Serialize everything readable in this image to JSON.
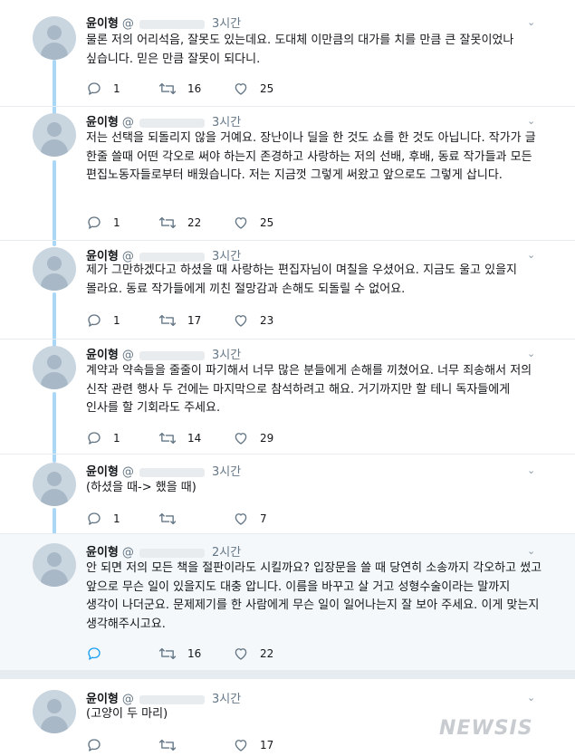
{
  "tweets": [
    {
      "name": "윤이형",
      "handle": "@",
      "time": "3시간",
      "text": "물론 저의 어리석음, 잘못도 있는데요. 도대체 이만큼의 대가를 치를 만큼 큰 잘못이었나 싶습니다. 믿은 만큼 잘못이 되다니.",
      "replies": "1",
      "retweets": "16",
      "likes": "25"
    },
    {
      "name": "윤이형",
      "handle": "@",
      "time": "3시간",
      "text": "저는 선택을 되돌리지 않을 거예요. 장난이나 딜을 한 것도 쇼를 한 것도 아닙니다. 작가가 글 한줄 쓸때 어떤 각오로 써야 하는지 존경하고 사랑하는 저의 선배, 후배, 동료 작가들과 모든 편집노동자들로부터 배웠습니다. 저는 지금껏 그렇게 써왔고 앞으로도 그렇게 삽니다.",
      "replies": "1",
      "retweets": "22",
      "likes": "25"
    },
    {
      "name": "윤이형",
      "handle": "@",
      "time": "3시간",
      "text": "제가 그만하겠다고 하셨을 때 사랑하는 편집자님이 며칠을 우셨어요. 지금도 울고 있을지 몰라요. 동료 작가들에게 끼친 절망감과 손해도 되돌릴 수 없어요.",
      "replies": "1",
      "retweets": "17",
      "likes": "23"
    },
    {
      "name": "윤이형",
      "handle": "@",
      "time": "3시간",
      "text": "계약과 약속들을 줄줄이 파기해서 너무 많은 분들에게 손해를 끼쳤어요. 너무 죄송해서 저의 신작 관련 행사 두 건에는 마지막으로 참석하려고 해요. 거기까지만 할 테니 독자들에게 인사를 할 기회라도 주세요.",
      "replies": "1",
      "retweets": "14",
      "likes": "29"
    },
    {
      "name": "윤이형",
      "handle": "@",
      "time": "3시간",
      "text": "(하셨을 때-> 했을 때)",
      "replies": "1",
      "retweets": "",
      "likes": "7"
    },
    {
      "name": "윤이형",
      "handle": "@",
      "time": "2시간",
      "text": "안 되면 저의 모든 책을 절판이라도 시킬까요? 입장문을 쓸 때 당연히 소송까지 각오하고 썼고 앞으로 무슨 일이 있을지도 대충 압니다. 이름을 바꾸고 살 거고 성형수술이라는 말까지 생각이 나더군요. 문제제기를 한 사람에게 무슨 일이 일어나는지 잘 보아 주세요. 이게 맞는지 생각해주시고요.",
      "replies": "",
      "retweets": "16",
      "likes": "22"
    },
    {
      "name": "윤이형",
      "handle": "@",
      "time": "3시간",
      "text": "(고양이 두 마리)",
      "replies": "",
      "retweets": "",
      "likes": "17"
    }
  ],
  "watermark": "NEWSIS",
  "icons": {
    "reply": "reply-icon",
    "retweet": "retweet-icon",
    "like": "heart-icon",
    "more": "chevron-down-icon"
  },
  "colors": {
    "accent": "#1da1f2",
    "thread_line": "#a9d7f5",
    "muted": "#657786",
    "highlight_bg": "#f5f8fa"
  }
}
